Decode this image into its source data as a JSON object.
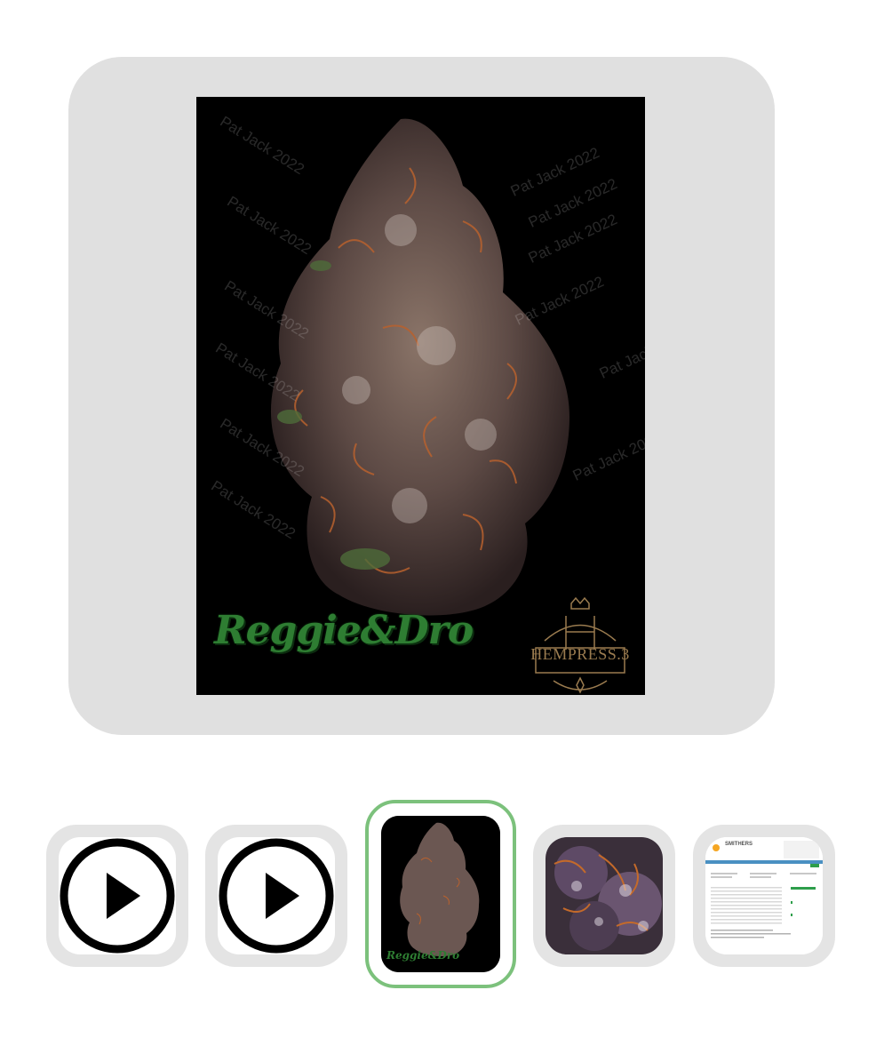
{
  "main_image": {
    "watermark": "Pat Jack 2022",
    "brand_left": "Reggie&Dro",
    "brand_right": "HEMPRESS.3"
  },
  "thumbnails": [
    {
      "type": "video",
      "icon": "play-icon"
    },
    {
      "type": "video",
      "icon": "play-icon"
    },
    {
      "type": "image",
      "selected": true,
      "brand": "Reggie&Dro"
    },
    {
      "type": "image"
    },
    {
      "type": "image",
      "brand": "SMITHERS"
    }
  ],
  "colors": {
    "frame": "#e0e0e0",
    "active_border": "#7cc17c",
    "brand_green": "#2e7d32",
    "gold": "#9a7b4f"
  }
}
